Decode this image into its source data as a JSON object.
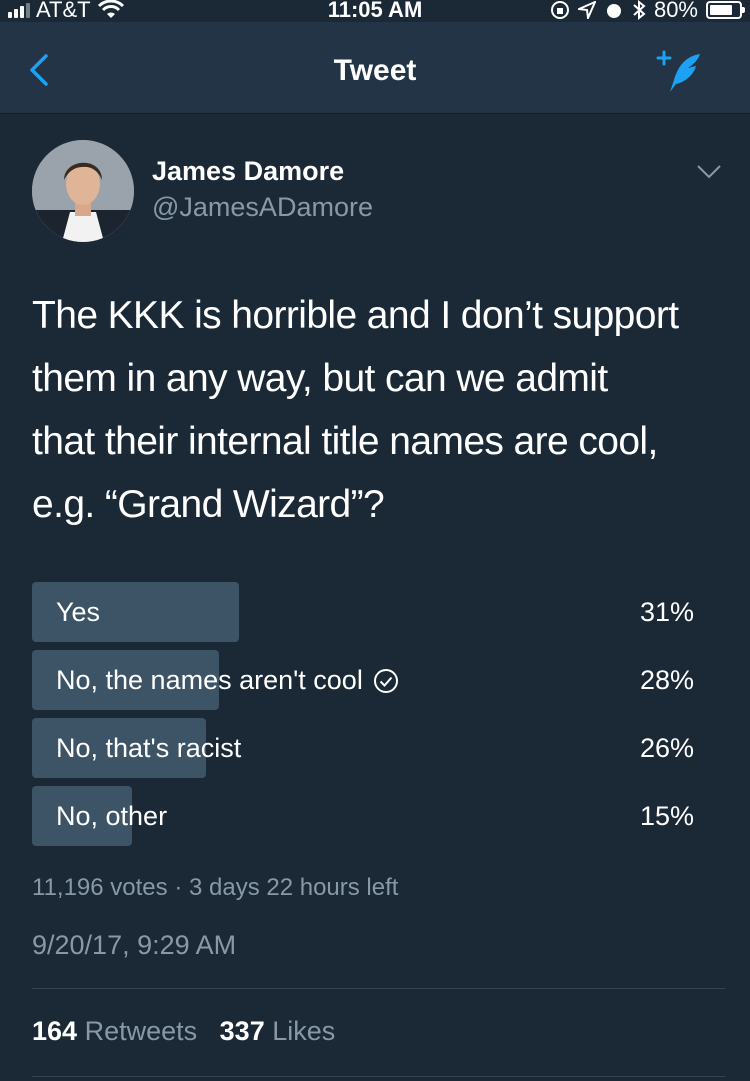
{
  "status_bar": {
    "carrier": "AT&T",
    "time": "11:05 AM",
    "battery": "80%",
    "battery_level": 0.8
  },
  "nav": {
    "title": "Tweet",
    "back_icon": "chevron-left-icon",
    "compose_icon": "compose-tweet-icon",
    "accent": "#1da1f2"
  },
  "author": {
    "name": "James Damore",
    "handle": "@JamesADamore"
  },
  "tweet": {
    "text_lines": [
      "The KKK is horrible and I don’t support",
      "them in any way, but can we admit",
      "that their internal title names are cool,",
      "e.g. “Grand Wizard”?"
    ]
  },
  "poll": {
    "options": [
      {
        "label": "Yes",
        "percent_label": "31%",
        "share": 0.31,
        "voted": false
      },
      {
        "label": "No, the names aren't cool",
        "percent_label": "28%",
        "share": 0.28,
        "voted": true
      },
      {
        "label": "No, that's racist",
        "percent_label": "26%",
        "share": 0.26,
        "voted": false
      },
      {
        "label": "No, other",
        "percent_label": "15%",
        "share": 0.15,
        "voted": false
      }
    ],
    "meta": "11,196 votes · 3 days 22 hours left"
  },
  "timestamp": "9/20/17, 9:29 AM",
  "stats": {
    "retweets_count": "164",
    "retweets_label": "Retweets",
    "likes_count": "337",
    "likes_label": "Likes"
  }
}
